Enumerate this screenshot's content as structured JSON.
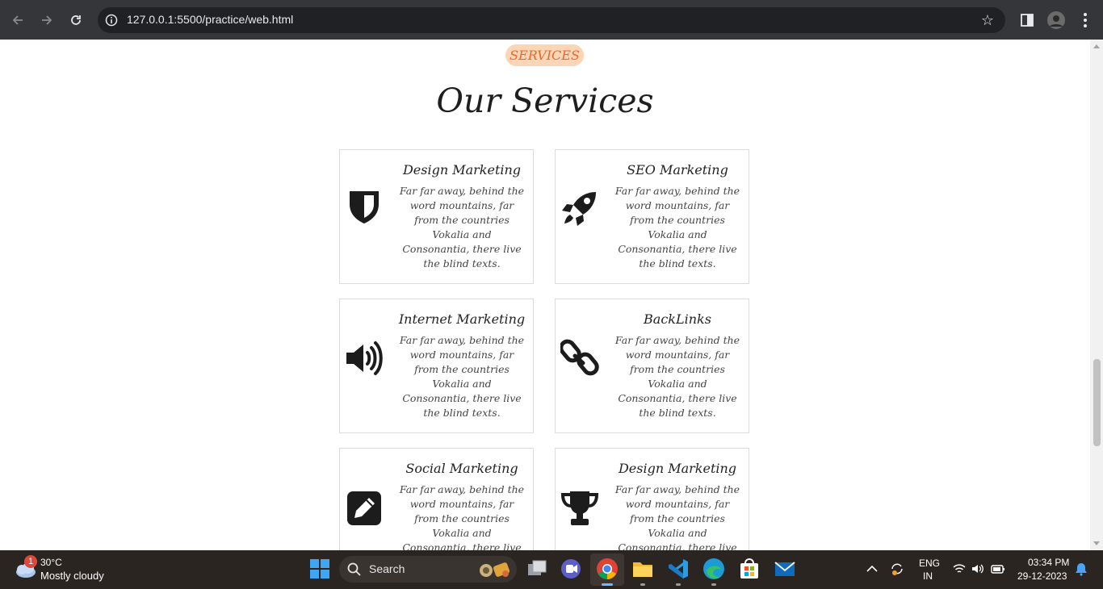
{
  "browser": {
    "url": "127.0.0.1:5500/practice/web.html"
  },
  "page": {
    "badge": "SERVICES",
    "heading": "Our Services",
    "cards": [
      {
        "title": "Design Marketing",
        "desc": "Far far away, behind the word mountains, far from the countries Vokalia and Consonantia, there live the blind texts.",
        "icon": "shield-icon"
      },
      {
        "title": "SEO Marketing",
        "desc": "Far far away, behind the word mountains, far from the countries Vokalia and Consonantia, there live the blind texts.",
        "icon": "rocket-icon"
      },
      {
        "title": "Internet Marketing",
        "desc": "Far far away, behind the word mountains, far from the countries Vokalia and Consonantia, there live the blind texts.",
        "icon": "volume-icon"
      },
      {
        "title": "BackLinks",
        "desc": "Far far away, behind the word mountains, far from the countries Vokalia and Consonantia, there live the blind texts.",
        "icon": "link-icon"
      },
      {
        "title": "Social Marketing",
        "desc": "Far far away, behind the word mountains, far from the countries Vokalia and Consonantia, there live the blind texts.",
        "icon": "pencil-square-icon"
      },
      {
        "title": "Design Marketing",
        "desc": "Far far away, behind the word mountains, far from the countries Vokalia and Consonantia, there live the blind texts.",
        "icon": "trophy-icon"
      }
    ]
  },
  "taskbar": {
    "weather_badge": "1",
    "temperature": "30°C",
    "condition": "Mostly cloudy",
    "search_label": "Search",
    "lang_primary": "ENG",
    "lang_secondary": "IN",
    "time": "03:34 PM",
    "date": "29-12-2023",
    "apps": [
      "windows-start",
      "task-view",
      "teams",
      "chrome",
      "file-explorer",
      "vs-code",
      "edge",
      "microsoft-store",
      "mail"
    ]
  }
}
